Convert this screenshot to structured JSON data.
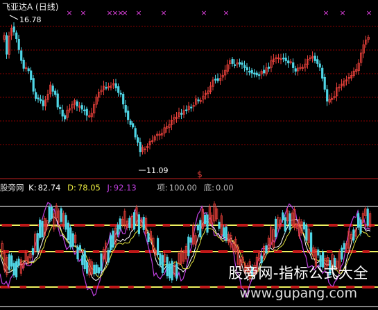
{
  "header": {
    "title": "飞亚达A (日线)"
  },
  "upper": {
    "high_label": "16.78",
    "low_label": "11.09",
    "signal_glyph": "$",
    "x_marker_glyph": "×",
    "x_marker_count": 13
  },
  "indicator": {
    "name": "股旁网",
    "k_label": "K:",
    "k_value": "82.74",
    "d_label": "D:",
    "d_value": "78.05",
    "j_label": "J:",
    "j_value": "92.13",
    "top_label": "项:",
    "top_value": "100.00",
    "bottom_label": "底:",
    "bottom_value": "0.00"
  },
  "watermark": {
    "line1": "股旁网-指标公式大全",
    "line2": "www.gupang.com"
  },
  "colors": {
    "up": "#e8403a",
    "down": "#4fd6e6",
    "x_marker": "#e040e0",
    "dashed": "#8b0000",
    "k_line": "#ffffff",
    "d_line": "#e8e840",
    "j_line": "#c040e0",
    "level_yellow": "#f0f060",
    "level_gray": "#b0b0b0"
  }
}
